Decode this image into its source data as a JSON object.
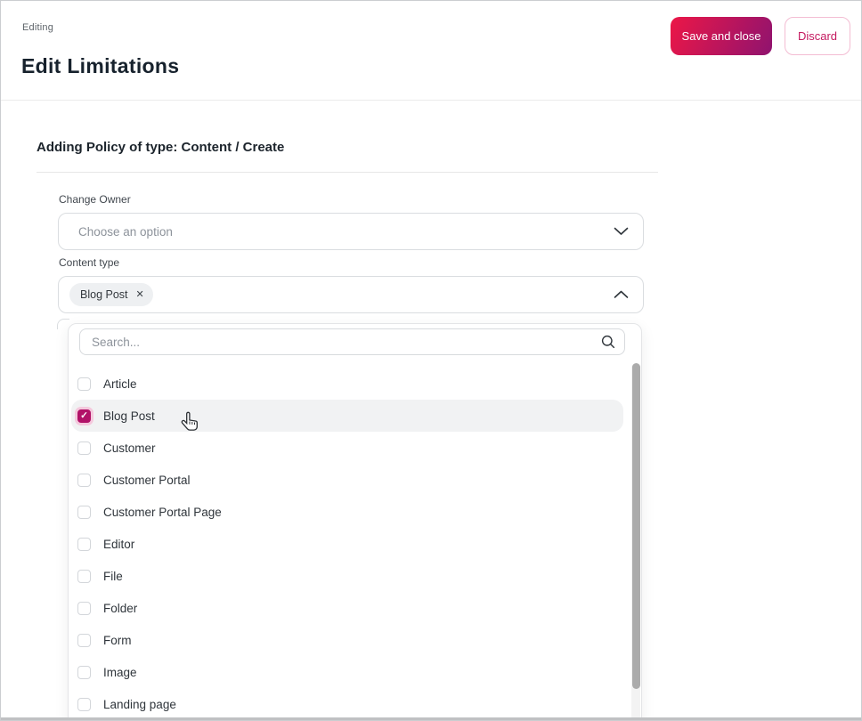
{
  "header": {
    "status_label": "Editing",
    "title": "Edit Limitations",
    "save_button_label": "Save and close",
    "discard_button_label": "Discard"
  },
  "form": {
    "section_heading": "Adding Policy of type: Content / Create",
    "change_owner": {
      "label": "Change Owner",
      "placeholder": "Choose an option"
    },
    "content_type": {
      "label": "Content type",
      "selected_chip": "Blog Post"
    }
  },
  "dropdown": {
    "search_placeholder": "Search...",
    "search_value": "",
    "options": [
      {
        "label": "Article",
        "checked": false,
        "highlighted": false
      },
      {
        "label": "Blog Post",
        "checked": true,
        "highlighted": true
      },
      {
        "label": "Customer",
        "checked": false,
        "highlighted": false
      },
      {
        "label": "Customer Portal",
        "checked": false,
        "highlighted": false
      },
      {
        "label": "Customer Portal Page",
        "checked": false,
        "highlighted": false
      },
      {
        "label": "Editor",
        "checked": false,
        "highlighted": false
      },
      {
        "label": "File",
        "checked": false,
        "highlighted": false
      },
      {
        "label": "Folder",
        "checked": false,
        "highlighted": false
      },
      {
        "label": "Form",
        "checked": false,
        "highlighted": false
      },
      {
        "label": "Image",
        "checked": false,
        "highlighted": false
      },
      {
        "label": "Landing page",
        "checked": false,
        "highlighted": false
      }
    ]
  },
  "icons": {
    "remove_chip_glyph": "✕",
    "checkmark_glyph": "✓"
  },
  "colors": {
    "accent_gradient_start": "#ec1747",
    "accent_gradient_end": "#8f136f",
    "accent_text": "#c4195f",
    "checkbox_checked": "#b11268",
    "checkbox_ring": "#f4c9dd",
    "row_highlight": "#f1f2f3",
    "title_text": "#17222d",
    "field_border": "#dadde0",
    "scroll_thumb": "#ababab"
  }
}
